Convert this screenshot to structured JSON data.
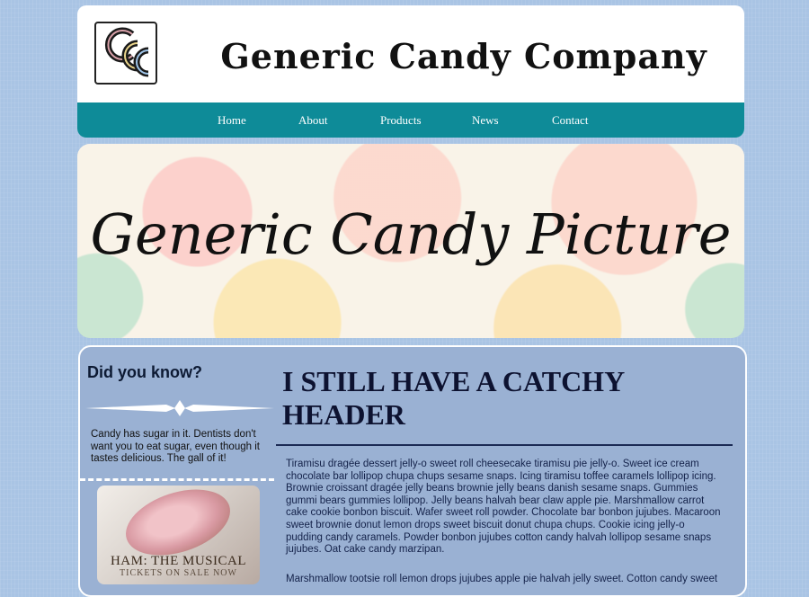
{
  "header": {
    "logo_text": "GCC",
    "site_title": "Generic Candy Company"
  },
  "nav": {
    "items": [
      "Home",
      "About",
      "Products",
      "News",
      "Contact"
    ]
  },
  "hero": {
    "text": "Generic Candy Picture"
  },
  "sidebar": {
    "heading": "Did you know?",
    "fact": "Candy has sugar in it. Dentists don't want you to eat sugar, even though it tastes delicious. The gall of it!",
    "ad_title": "HAM: THE MUSICAL",
    "ad_subtitle": "TICKETS ON SALE NOW"
  },
  "content": {
    "header": "I STILL HAVE A CATCHY HEADER",
    "paragraphs": [
      "Tiramisu dragée dessert jelly-o sweet roll cheesecake tiramisu pie jelly-o. Sweet ice cream chocolate bar lollipop chupa chups sesame snaps. Icing tiramisu toffee caramels lollipop icing. Brownie croissant dragée jelly beans brownie jelly beans danish sesame snaps. Gummies gummi bears gummies lollipop. Jelly beans halvah bear claw apple pie. Marshmallow carrot cake cookie bonbon biscuit. Wafer sweet roll powder. Chocolate bar bonbon jujubes. Macaroon sweet brownie donut lemon drops sweet biscuit donut chupa chups. Cookie icing jelly-o pudding candy caramels. Powder bonbon jujubes cotton candy halvah lollipop sesame snaps jujubes. Oat cake candy marzipan.",
      "Marshmallow tootsie roll lemon drops jujubes apple pie halvah jelly sweet. Cotton candy sweet"
    ]
  },
  "colors": {
    "page_background": "#a9c4e4",
    "nav_background": "#0e8b98",
    "main_panel": "#9ab1d3",
    "header_text": "#0d1230"
  }
}
